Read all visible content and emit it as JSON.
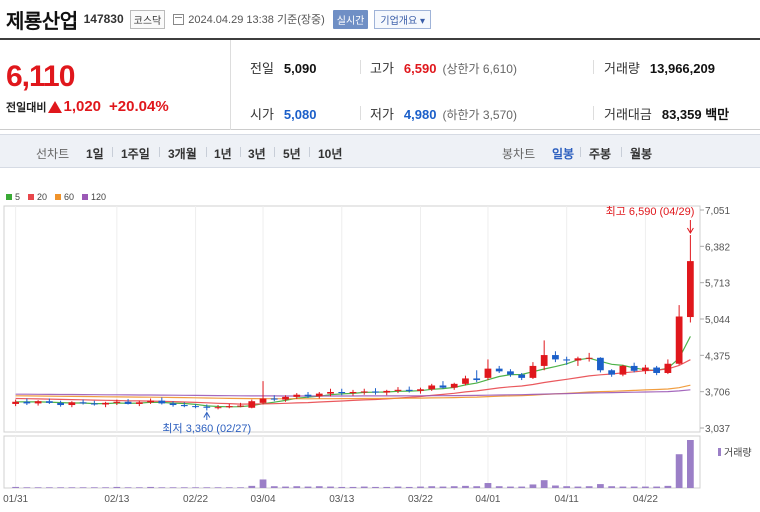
{
  "header": {
    "company": "제룡산업",
    "code": "147830",
    "market": "코스닥",
    "datetime": "2024.04.29 13:38  기준(장중)",
    "realtime": "실시간",
    "overview": "기업개요 ▾"
  },
  "price": {
    "current": "6,110",
    "change_label": "전일대비",
    "change": "1,020",
    "change_pct": "+20.04%",
    "up_color": "#e0171c",
    "down_color": "#1b5fc9"
  },
  "stats": {
    "prev_close": {
      "label": "전일",
      "value": "5,090"
    },
    "open": {
      "label": "시가",
      "value": "5,080"
    },
    "high": {
      "label": "고가",
      "value": "6,590",
      "sub": "(상한가 6,610)"
    },
    "low": {
      "label": "저가",
      "value": "4,980",
      "sub": "(하한가 3,570)"
    },
    "volume": {
      "label": "거래량",
      "value": "13,966,209"
    },
    "amount": {
      "label": "거래대금",
      "value": "83,359 백만"
    }
  },
  "toolbar": {
    "line_label": "선차트",
    "periods": [
      "1일",
      "1주일",
      "3개월",
      "1년",
      "3년",
      "5년",
      "10년"
    ],
    "candle_label": "봉차트",
    "candle_types": [
      "일봉",
      "주봉",
      "월봉"
    ],
    "active_candle": "일봉"
  },
  "chart_data": {
    "type": "candlestick",
    "legend": [
      {
        "name": "5",
        "color": "#3aaa35"
      },
      {
        "name": "20",
        "color": "#e8474c"
      },
      {
        "name": "60",
        "color": "#f0932b"
      },
      {
        "name": "120",
        "color": "#9b59b6"
      }
    ],
    "yticks": [
      7051,
      6382,
      5713,
      5044,
      4375,
      3706,
      3037
    ],
    "ylim": [
      3037,
      7051
    ],
    "xticks": [
      "01/31",
      "02/13",
      "02/22",
      "03/04",
      "03/13",
      "03/22",
      "04/01",
      "04/11",
      "04/22"
    ],
    "xtick_index": [
      0,
      9,
      16,
      22,
      29,
      36,
      42,
      49,
      56
    ],
    "annot_high": "최고 6,590 (04/29)",
    "annot_low": "최저 3,360 (02/27)",
    "volume_label": "거래량",
    "candles": [
      [
        3480,
        3560,
        3440,
        3520
      ],
      [
        3520,
        3580,
        3460,
        3490
      ],
      [
        3490,
        3550,
        3450,
        3530
      ],
      [
        3530,
        3580,
        3480,
        3500
      ],
      [
        3500,
        3540,
        3430,
        3460
      ],
      [
        3460,
        3530,
        3420,
        3510
      ],
      [
        3510,
        3560,
        3470,
        3490
      ],
      [
        3490,
        3540,
        3450,
        3470
      ],
      [
        3470,
        3520,
        3420,
        3500
      ],
      [
        3500,
        3560,
        3460,
        3520
      ],
      [
        3520,
        3570,
        3470,
        3480
      ],
      [
        3480,
        3540,
        3440,
        3510
      ],
      [
        3510,
        3580,
        3480,
        3540
      ],
      [
        3540,
        3600,
        3470,
        3490
      ],
      [
        3490,
        3530,
        3430,
        3460
      ],
      [
        3460,
        3510,
        3420,
        3440
      ],
      [
        3440,
        3480,
        3400,
        3430
      ],
      [
        3430,
        3470,
        3360,
        3410
      ],
      [
        3410,
        3460,
        3380,
        3420
      ],
      [
        3420,
        3480,
        3400,
        3440
      ],
      [
        3440,
        3500,
        3420,
        3450
      ],
      [
        3410,
        3560,
        3400,
        3530
      ],
      [
        3500,
        3900,
        3470,
        3580
      ],
      [
        3580,
        3640,
        3530,
        3560
      ],
      [
        3560,
        3640,
        3520,
        3610
      ],
      [
        3610,
        3680,
        3570,
        3650
      ],
      [
        3650,
        3700,
        3590,
        3620
      ],
      [
        3620,
        3700,
        3580,
        3670
      ],
      [
        3670,
        3760,
        3620,
        3700
      ],
      [
        3700,
        3760,
        3640,
        3680
      ],
      [
        3680,
        3740,
        3630,
        3700
      ],
      [
        3700,
        3760,
        3650,
        3710
      ],
      [
        3710,
        3770,
        3650,
        3690
      ],
      [
        3690,
        3740,
        3640,
        3720
      ],
      [
        3720,
        3790,
        3680,
        3740
      ],
      [
        3740,
        3800,
        3690,
        3720
      ],
      [
        3720,
        3780,
        3670,
        3750
      ],
      [
        3750,
        3850,
        3720,
        3820
      ],
      [
        3820,
        3900,
        3760,
        3780
      ],
      [
        3780,
        3870,
        3740,
        3850
      ],
      [
        3850,
        4000,
        3820,
        3950
      ],
      [
        3950,
        4100,
        3880,
        3920
      ],
      [
        3960,
        4300,
        3920,
        4130
      ],
      [
        4130,
        4180,
        4050,
        4080
      ],
      [
        4080,
        4120,
        3980,
        4020
      ],
      [
        4020,
        4050,
        3920,
        3960
      ],
      [
        3960,
        4250,
        3940,
        4180
      ],
      [
        4180,
        4650,
        4100,
        4380
      ],
      [
        4380,
        4450,
        4250,
        4300
      ],
      [
        4300,
        4350,
        4200,
        4280
      ],
      [
        4280,
        4350,
        4180,
        4320
      ],
      [
        4320,
        4420,
        4260,
        4330
      ],
      [
        4330,
        4340,
        4060,
        4100
      ],
      [
        4100,
        4120,
        3980,
        4020
      ],
      [
        4020,
        4200,
        3990,
        4180
      ],
      [
        4180,
        4240,
        4060,
        4090
      ],
      [
        4090,
        4200,
        4030,
        4150
      ],
      [
        4150,
        4180,
        4010,
        4050
      ],
      [
        4050,
        4300,
        4030,
        4220
      ],
      [
        4220,
        5300,
        4200,
        5090
      ],
      [
        5080,
        6590,
        4980,
        6110
      ]
    ],
    "volumes": [
      3,
      2,
      2,
      2,
      2,
      2,
      2,
      2,
      2,
      3,
      2,
      2,
      3,
      2,
      2,
      2,
      2,
      2,
      2,
      2,
      2,
      6,
      24,
      5,
      4,
      5,
      4,
      5,
      4,
      3,
      3,
      4,
      3,
      3,
      4,
      3,
      4,
      5,
      4,
      5,
      6,
      5,
      14,
      5,
      4,
      4,
      10,
      22,
      7,
      5,
      4,
      5,
      11,
      5,
      4,
      4,
      4,
      4,
      6,
      95,
      135
    ]
  }
}
